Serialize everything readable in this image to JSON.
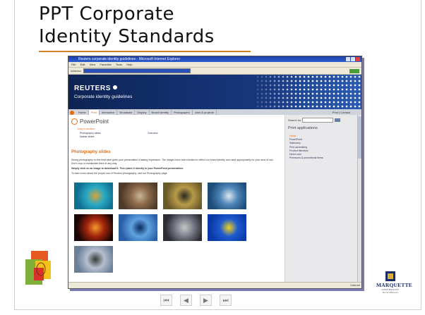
{
  "slide": {
    "title_line1": "PPT Corporate",
    "title_line2": "Identity Standards",
    "accent": "#d5801e"
  },
  "browser": {
    "window_title": "Reuters corporate identity guidelines - Microsoft Internet Explorer",
    "menu": [
      "File",
      "Edit",
      "View",
      "Favorites",
      "Tools",
      "Help"
    ],
    "address_label": "Address"
  },
  "site": {
    "logo": "REUTERS",
    "subtitle": "Corporate identity guidelines",
    "nav_tabs": [
      "Home",
      "Print",
      "Interactive",
      "Broadcast",
      "Display",
      "Brand identity",
      "Photographs",
      "Jobs & projects"
    ],
    "active_tab_index": 1,
    "print_link": "Print | Contact",
    "page_title": "PowerPoint",
    "jump_label": "Jump to section:",
    "jump_links": [
      "Photography slides",
      "Master slides"
    ],
    "jump_link_right": "Overview",
    "section_heading": "Photography slides",
    "body_1": "Strong photography on the final slide gives your presentation a lasting impression. The images have been treated to reflect our brand identity and used appropriately for your area of use. Don't crop or manipulate them in any way.",
    "body_2": "Simply click on an image to download it. Then place it directly in your PowerPoint presentation.",
    "body_3": "To learn more about the proper use of Reuters photography, visit our Photography page.",
    "thumbnails": [
      {
        "name": "diver",
        "colors": [
          "#0e6f8e",
          "#2aa9c4",
          "#d8a23a"
        ]
      },
      {
        "name": "hay-bale",
        "colors": [
          "#4d3a2a",
          "#8c6a4a",
          "#c9b49a"
        ]
      },
      {
        "name": "field",
        "colors": [
          "#6a5a2a",
          "#b79a48",
          "#2c2a20"
        ]
      },
      {
        "name": "boats",
        "colors": [
          "#1e4d7a",
          "#4f86b8",
          "#dfe7ef"
        ]
      },
      {
        "name": "lights",
        "colors": [
          "#1a0606",
          "#a3240c",
          "#f39a2a"
        ]
      },
      {
        "name": "architecture",
        "colors": [
          "#2a5fa8",
          "#5fa3e0",
          "#0b2a60"
        ]
      },
      {
        "name": "cyclists",
        "colors": [
          "#2c2c34",
          "#7a7f8a",
          "#c6c6c6"
        ]
      },
      {
        "name": "eu-flag",
        "colors": [
          "#0a3aa8",
          "#1f5bd0",
          "#f3d21a"
        ]
      },
      {
        "name": "landscape",
        "colors": [
          "#6b7f9a",
          "#b6c0ce",
          "#3a3a3a"
        ]
      }
    ],
    "search_label": "Search for",
    "sidebar_heading": "Print applications",
    "sidebar_links": [
      "Home",
      "PowerPoint",
      "Stationery",
      "Print advertising",
      "Product literature",
      "Direct mail",
      "Premiums & promotional items"
    ],
    "status_right": "Internet"
  },
  "logos": {
    "university_name": "MARQUETTE",
    "university_sub": "UNIVERSITY",
    "university_tag": "Be The Difference"
  },
  "player": {
    "first": "⏮",
    "prev": "◀",
    "next": "▶",
    "last": "⏭"
  }
}
